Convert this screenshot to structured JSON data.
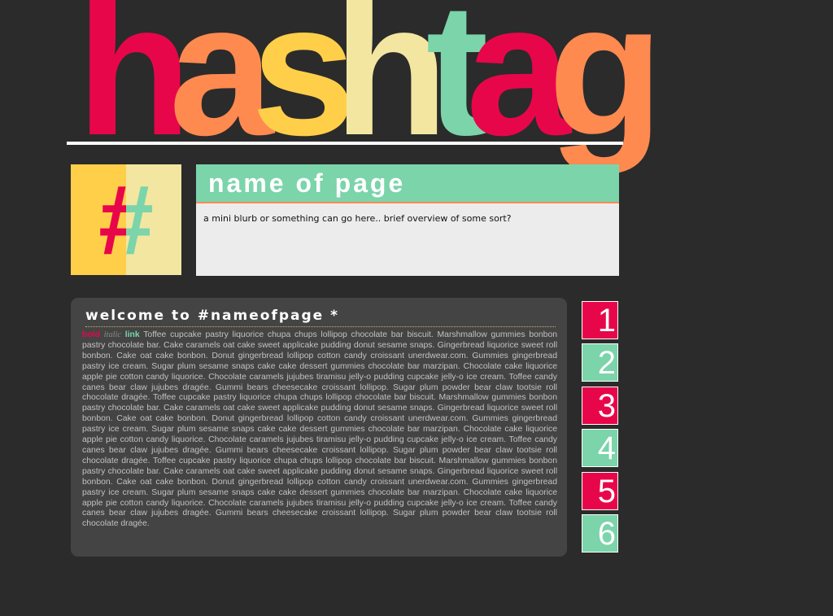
{
  "colors": {
    "background": "#2b2b2b",
    "red": "#e8064a",
    "orange": "#ff8a50",
    "yellow": "#ffcf4a",
    "cream": "#f2e6a1",
    "mint": "#7bd4aa",
    "panel": "#444444",
    "text_gray": "#c2c2c2"
  },
  "logo": {
    "letters": [
      {
        "char": "h",
        "color": "#e8064a"
      },
      {
        "char": "a",
        "color": "#ff8a50"
      },
      {
        "char": "s",
        "color": "#ffcf4a"
      },
      {
        "char": "h",
        "color": "#f2e6a1"
      },
      {
        "char": "t",
        "color": "#7bd4aa"
      },
      {
        "char": "a",
        "color": "#e8064a"
      },
      {
        "char": "g",
        "color": "#ff8a50"
      }
    ]
  },
  "hash_box": {
    "glyph": "#",
    "left_bg": "#ffcf4a",
    "right_bg": "#f2e6a1",
    "left_glyph_color": "#e8064a",
    "right_glyph_color": "#7bd4aa"
  },
  "header": {
    "title": "name of page",
    "title_bg": "#7bd4aa",
    "blurb": "a mini blurb or something can go here.. brief overview of some sort?"
  },
  "content": {
    "heading": "welcome to #nameofpage *",
    "bold_label": "bold",
    "italic_label": "italic",
    "link_label": "link",
    "body": "Toffee cupcake pastry liquorice chupa chups lollipop chocolate bar biscuit. Marshmallow gummies bonbon pastry chocolate bar. Cake caramels oat cake sweet applicake pudding donut sesame snaps. Gingerbread liquorice sweet roll bonbon. Cake oat cake bonbon. Donut gingerbread lollipop cotton candy croissant unerdwear.com. Gummies gingerbread pastry ice cream. Sugar plum sesame snaps cake cake dessert gummies chocolate bar marzipan. Chocolate cake liquorice apple pie cotton candy liquorice. Chocolate caramels jujubes tiramisu jelly-o pudding cupcake jelly-o ice cream. Toffee candy canes bear claw jujubes dragée. Gummi bears cheesecake croissant lollipop. Sugar plum powder bear claw tootsie roll chocolate dragée. Toffee cupcake pastry liquorice chupa chups lollipop chocolate bar biscuit. Marshmallow gummies bonbon pastry chocolate bar. Cake caramels oat cake sweet applicake pudding donut sesame snaps. Gingerbread liquorice sweet roll bonbon. Cake oat cake bonbon. Donut gingerbread lollipop cotton candy croissant unerdwear.com. Gummies gingerbread pastry ice cream. Sugar plum sesame snaps cake cake dessert gummies chocolate bar marzipan. Chocolate cake liquorice apple pie cotton candy liquorice. Chocolate caramels jujubes tiramisu jelly-o pudding cupcake jelly-o ice cream. Toffee candy canes bear claw jujubes dragée. Gummi bears cheesecake croissant lollipop. Sugar plum powder bear claw tootsie roll chocolate dragée. Toffee cupcake pastry liquorice chupa chups lollipop chocolate bar biscuit. Marshmallow gummies bonbon pastry chocolate bar. Cake caramels oat cake sweet applicake pudding donut sesame snaps. Gingerbread liquorice sweet roll bonbon. Cake oat cake bonbon. Donut gingerbread lollipop cotton candy croissant unerdwear.com. Gummies gingerbread pastry ice cream. Sugar plum sesame snaps cake cake dessert gummies chocolate bar marzipan. Chocolate cake liquorice apple pie cotton candy liquorice. Chocolate caramels jujubes tiramisu jelly-o pudding cupcake jelly-o ice cream. Toffee candy canes bear claw jujubes dragée. Gummi bears cheesecake croissant lollipop. Sugar plum powder bear claw tootsie roll chocolate dragée."
  },
  "nav": {
    "items": [
      {
        "label": "1",
        "color": "#e8064a"
      },
      {
        "label": "2",
        "color": "#7bd4aa"
      },
      {
        "label": "3",
        "color": "#e8064a"
      },
      {
        "label": "4",
        "color": "#7bd4aa"
      },
      {
        "label": "5",
        "color": "#e8064a"
      },
      {
        "label": "6",
        "color": "#7bd4aa"
      }
    ]
  }
}
